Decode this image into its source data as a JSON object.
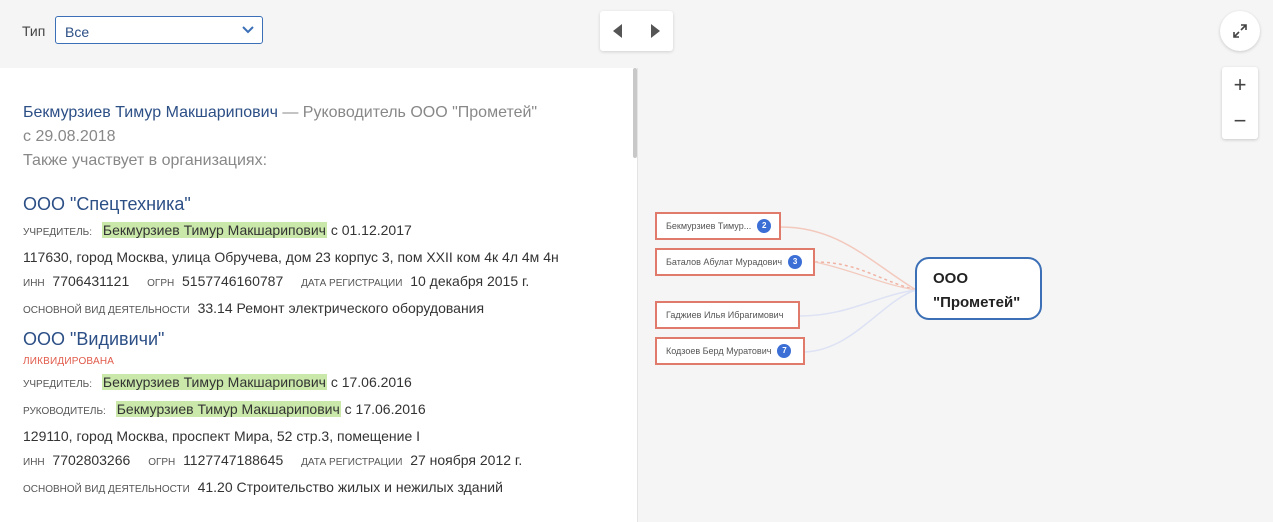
{
  "filter": {
    "label": "Тип",
    "value": "Все"
  },
  "intro": {
    "person_name": "Бекмурзиев Тимур Макшарипович",
    "role_text": " — Руководитель ООО \"Прометей\"",
    "since": "с 29.08.2018",
    "also": "Также участвует в организациях:"
  },
  "orgs": [
    {
      "name": "ООО \"Спецтехника\"",
      "founder_label": "учредитель:",
      "founder_name": "Бекмурзиев Тимур Макшарипович",
      "founder_since": " с 01.12.2017",
      "address": "117630, город Москва, улица Обручева, дом 23 корпус 3, пом XXII ком 4к 4л 4м 4н",
      "inn_label": "инн",
      "inn": "7706431121",
      "ogrn_label": "огрн",
      "ogrn": "5157746160787",
      "reg_label": "дата регистрации",
      "reg_date": "10 декабря 2015 г.",
      "activity_label": "основной вид деятельности",
      "activity": "33.14 Ремонт электрического оборудования"
    },
    {
      "name": "ООО \"Видивичи\"",
      "status": "ликвидирована",
      "founder_label": "учредитель:",
      "founder_name": "Бекмурзиев Тимур Макшарипович",
      "founder_since": " с 17.06.2016",
      "head_label": "руководитель:",
      "head_name": "Бекмурзиев Тимур Макшарипович",
      "head_since": " с 17.06.2016",
      "address": "129110, город Москва, проспект Мира, 52 стр.3, помещение I",
      "inn_label": "инн",
      "inn": "7702803266",
      "ogrn_label": "огрн",
      "ogrn": "1127747188645",
      "reg_label": "дата регистрации",
      "reg_date": "27 ноября 2012 г.",
      "activity_label": "основной вид деятельности",
      "activity": "41.20 Строительство жилых и нежилых зданий"
    }
  ],
  "graph": {
    "company": {
      "line1": "ООО",
      "line2": "\"Прометей\""
    },
    "people": [
      {
        "name": "Бекмурзиев Тимур...",
        "badge": "2"
      },
      {
        "name": "Баталов Абулат Мурадович",
        "badge": "3"
      },
      {
        "name": "Гаджиев Илья Ибрагимович",
        "badge": ""
      },
      {
        "name": "Кодзоев Берд Муратович",
        "badge": "7"
      }
    ]
  },
  "controls": {
    "zoom_in": "+",
    "zoom_out": "−"
  },
  "colors": {
    "link": "#2c4f86",
    "highlight": "#c9e8a9",
    "person_border": "#e07a6a",
    "company_border": "#3b6fb6",
    "badge": "#3b6fd6",
    "status": "#e05a4a"
  }
}
